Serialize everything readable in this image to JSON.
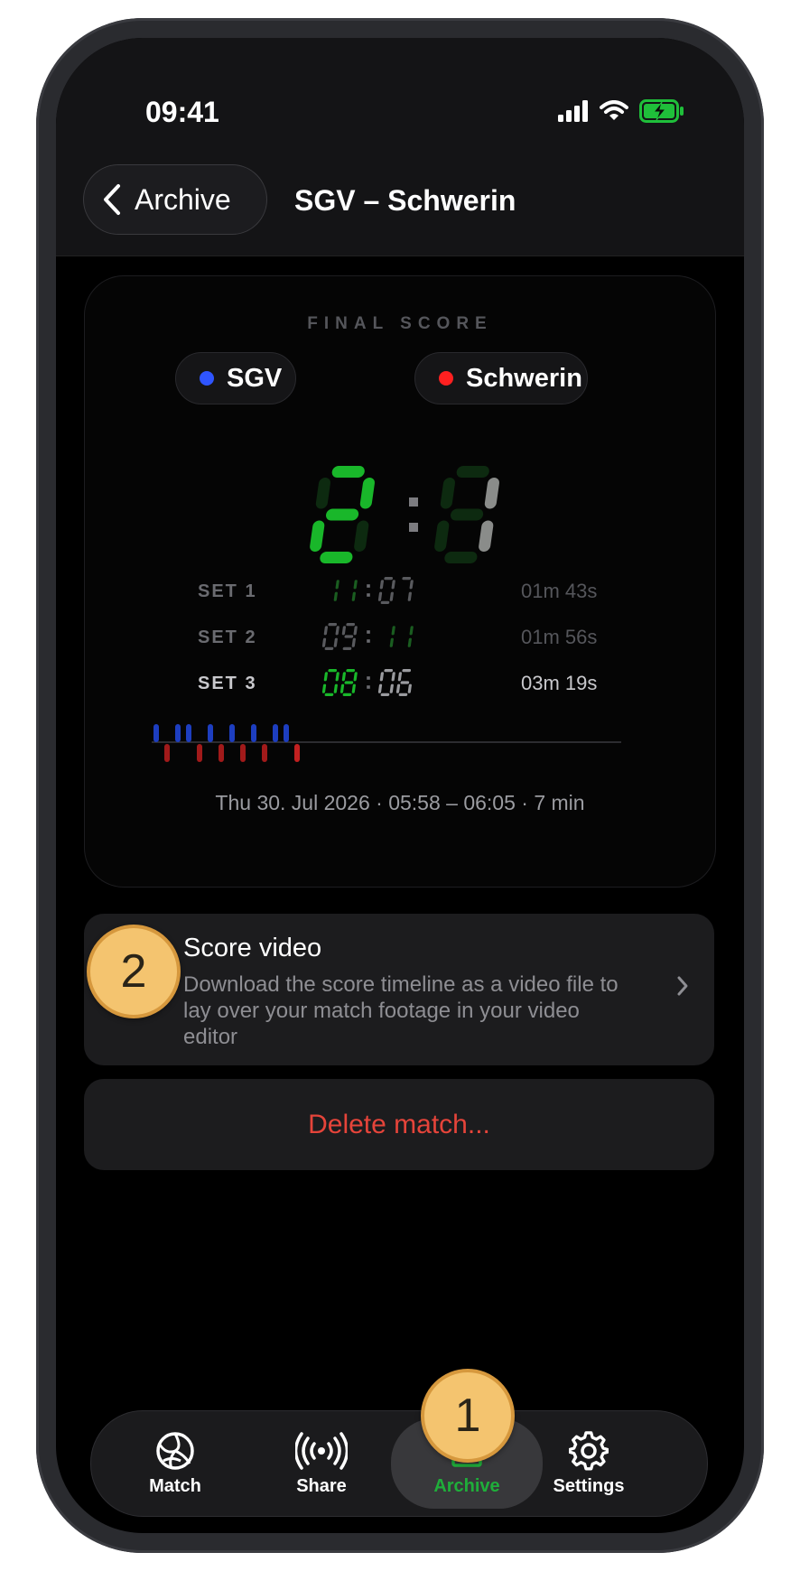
{
  "status_bar": {
    "time": "09:41"
  },
  "nav": {
    "back_label": "Archive",
    "title": "SGV – Schwerin"
  },
  "score_card": {
    "heading": "FINAL SCORE",
    "home_team": {
      "name": "SGV",
      "color": "#2f55ff"
    },
    "away_team": {
      "name": "Schwerin",
      "color": "#ff2020"
    },
    "final": {
      "home": "2",
      "away": "1"
    },
    "sets": [
      {
        "label": "SET 1",
        "home": "11",
        "away": "07",
        "duration": "01m 43s"
      },
      {
        "label": "SET 2",
        "home": "09",
        "away": "11",
        "duration": "01m 56s"
      },
      {
        "label": "SET 3",
        "home": "08",
        "away": "06",
        "duration": "03m 19s"
      }
    ],
    "date_line": "Thu 30. Jul 2026 · 05:58 – 06:05 · 7 min"
  },
  "score_video": {
    "title": "Score video",
    "description": "Download the score timeline as a video file to lay over your match footage in your video editor"
  },
  "delete_label": "Delete match...",
  "tabs": [
    {
      "label": "Match",
      "icon": "volleyball-icon"
    },
    {
      "label": "Share",
      "icon": "broadcast-icon"
    },
    {
      "label": "Archive",
      "icon": "archive-icon"
    },
    {
      "label": "Settings",
      "icon": "gear-icon"
    }
  ],
  "markers": [
    {
      "label": "1"
    },
    {
      "label": "2"
    }
  ],
  "colors": {
    "led_green": "#19b72a",
    "accent_green": "#1fae3a",
    "delete_red": "#e5443a"
  }
}
